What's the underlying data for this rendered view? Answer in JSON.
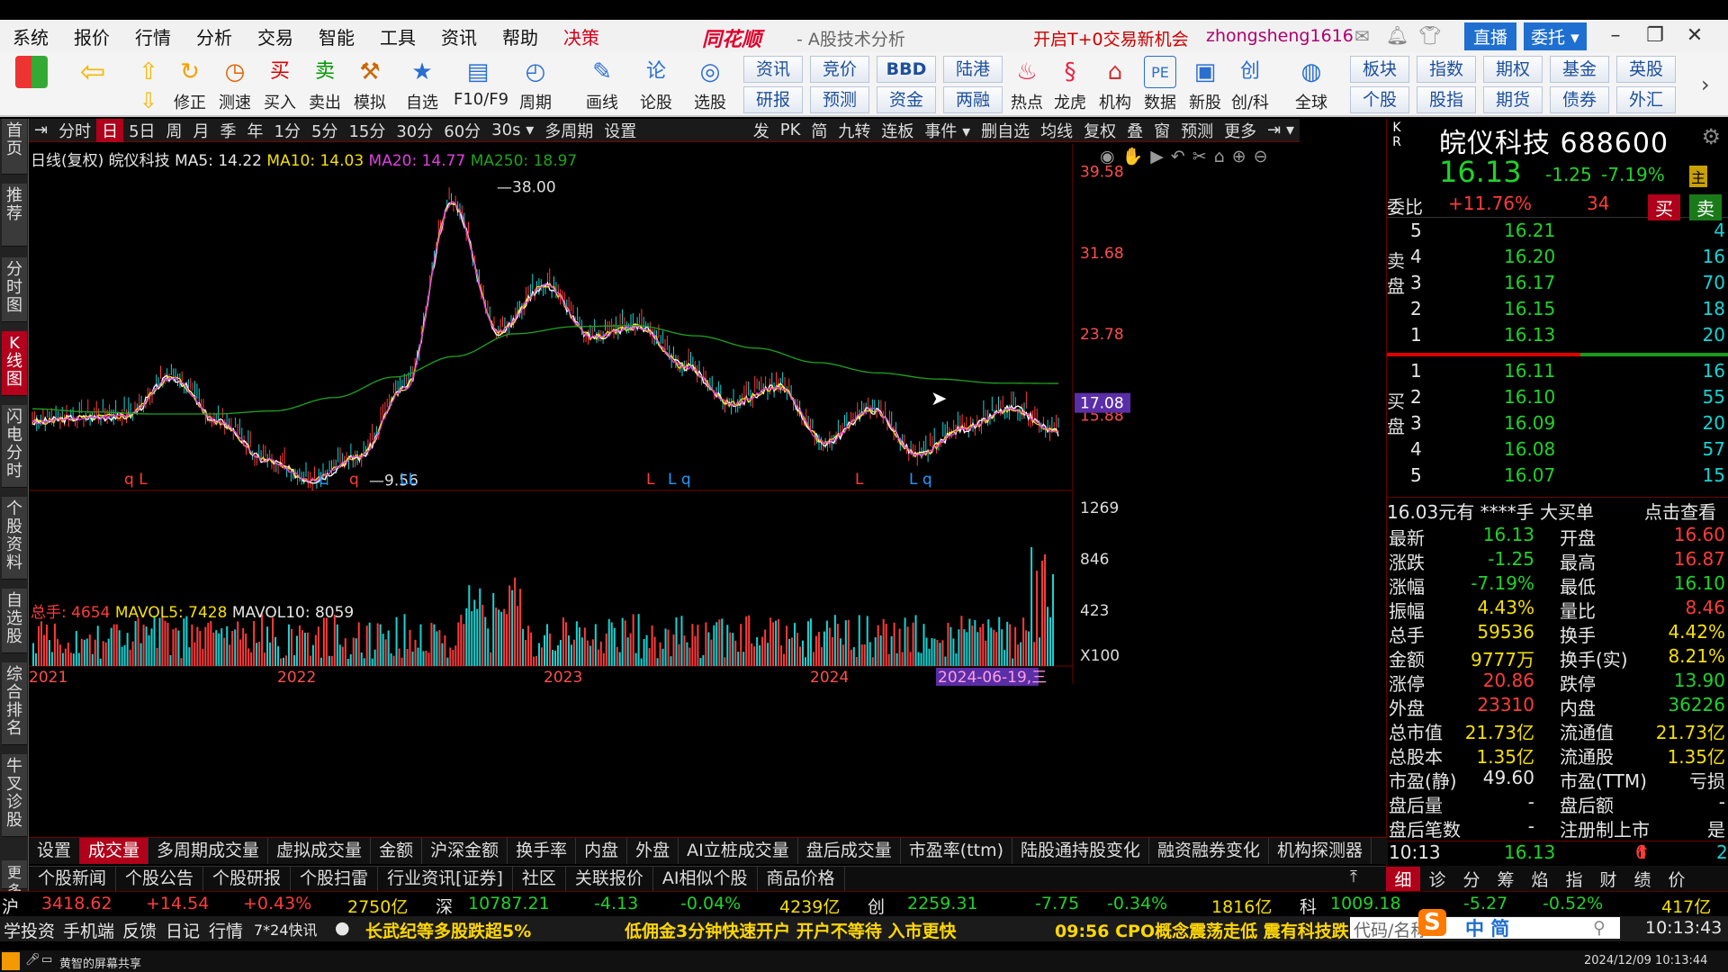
{
  "menu": {
    "items": [
      "系统",
      "报价",
      "行情",
      "分析",
      "交易",
      "智能",
      "工具",
      "资讯",
      "帮助",
      "决策"
    ],
    "brand": "同花顺",
    "subtitle": "- A股技术分析",
    "promo": "开启T+0交易新机会",
    "user": "zhongsheng1616",
    "live": "直播",
    "delegate": "委托"
  },
  "toolbar": {
    "buttons": [
      "修正",
      "测速",
      "买入",
      "卖出",
      "模拟",
      "自选",
      "F10/F9",
      "周期",
      "画线",
      "论股",
      "选股"
    ],
    "quick_top": [
      "资讯",
      "竞价",
      "BBD",
      "陆港"
    ],
    "quick_bottom": [
      "研报",
      "预测",
      "资金",
      "两融"
    ],
    "right_buttons": [
      "热点",
      "龙虎",
      "机构",
      "数据",
      "新股",
      "创/科",
      "全球"
    ],
    "right_quick_top": [
      "板块",
      "指数",
      "期权",
      "基金",
      "英股"
    ],
    "right_quick_bottom": [
      "个股",
      "股指",
      "期货",
      "债券",
      "外汇"
    ]
  },
  "left_tabs": [
    "首页",
    "推荐",
    "分时图",
    "K线图",
    "闪电分时",
    "个股资料",
    "自选股",
    "综合排名",
    "牛叉诊股",
    "更多"
  ],
  "chart_toolbar": {
    "periods": [
      "分时",
      "日",
      "5日",
      "周",
      "月",
      "季",
      "年",
      "1分",
      "5分",
      "15分",
      "30分",
      "60分",
      "30s",
      "多周期",
      "设置"
    ],
    "tools": [
      "发",
      "PK",
      "简",
      "九转",
      "连板",
      "事件",
      "删自选",
      "均线",
      "复权",
      "叠",
      "窗",
      "预测",
      "更多"
    ]
  },
  "chart_info": {
    "mode": "日线(复权)",
    "stock": "皖仪科技",
    "ma5_label": "MA5: 14.22",
    "ma10_label": "MA10: 14.03",
    "ma20_label": "MA20: 14.77",
    "ma250_label": "MA250: 18.97",
    "high_label": "38.00",
    "low_label": "9.56",
    "price_flag": "17.08",
    "vol_line_total": "总手: 4654",
    "vol_line_mavol5": "MAVOL5: 7428",
    "vol_line_mavol10": "MAVOL10: 8059",
    "vol_unit": "X100",
    "date_flag": "2024-06-19,三",
    "markers": [
      "q L",
      "L",
      "q",
      "LL",
      "L",
      "L q",
      "L",
      "L q"
    ]
  },
  "chart_data": {
    "type": "line",
    "title": "皖仪科技 日线(复权)",
    "x": [
      "2021",
      "2022",
      "2023",
      "2024"
    ],
    "price_ticks": [
      "39.58",
      "31.68",
      "23.78",
      "15.88"
    ],
    "volume_ticks": [
      "1269",
      "846",
      "423"
    ],
    "ylim": [
      9.0,
      40.5
    ],
    "series": [
      {
        "name": "MA250",
        "values": [
          16.5,
          16.2,
          16.0,
          16.0,
          16.3,
          17.6,
          19.6,
          21.6,
          23.8,
          24.5,
          24.6,
          23.6,
          22.4,
          21.0,
          20.0,
          19.4,
          19.0,
          18.97
        ]
      },
      {
        "name": "MA5",
        "values": [
          15.2,
          15.6,
          15.8,
          19.5,
          15.2,
          11.5,
          9.6,
          11.8,
          18.5,
          36.5,
          24.0,
          28.5,
          23.5,
          24.5,
          20.6,
          17.0,
          18.6,
          13.2,
          16.4,
          12.0,
          14.6,
          16.5,
          14.22
        ]
      }
    ],
    "volume": {
      "total": 4654,
      "mavol5": 7428,
      "mavol10": 8059
    }
  },
  "quote": {
    "kr": "K R",
    "name": "皖仪科技 688600",
    "price": "16.13",
    "change": "-1.25",
    "pct": "-7.19%",
    "zhu": "主",
    "weibi_label": "委比",
    "weibi_value": "+11.76%",
    "weicha": "34",
    "buy_btn": "买",
    "sell_btn": "卖",
    "sell_label": "卖盘",
    "buy_label": "买盘",
    "asks": [
      {
        "lvl": "5",
        "px": "16.21",
        "vol": "4"
      },
      {
        "lvl": "4",
        "px": "16.20",
        "vol": "16"
      },
      {
        "lvl": "3",
        "px": "16.17",
        "vol": "70"
      },
      {
        "lvl": "2",
        "px": "16.15",
        "vol": "18"
      },
      {
        "lvl": "1",
        "px": "16.13",
        "vol": "20"
      }
    ],
    "bids": [
      {
        "lvl": "1",
        "px": "16.11",
        "vol": "16"
      },
      {
        "lvl": "2",
        "px": "16.10",
        "vol": "55"
      },
      {
        "lvl": "3",
        "px": "16.09",
        "vol": "20"
      },
      {
        "lvl": "4",
        "px": "16.08",
        "vol": "57"
      },
      {
        "lvl": "5",
        "px": "16.07",
        "vol": "15"
      }
    ],
    "bigorder": "16.03元有 ****手 大买单",
    "bigorder_link": "点击查看",
    "stats": [
      {
        "l1": "最新",
        "v1": "16.13",
        "c1": "grn",
        "l2": "开盘",
        "v2": "16.60",
        "c2": "red"
      },
      {
        "l1": "涨跌",
        "v1": "-1.25",
        "c1": "grn",
        "l2": "最高",
        "v2": "16.87",
        "c2": "red"
      },
      {
        "l1": "涨幅",
        "v1": "-7.19%",
        "c1": "grn",
        "l2": "最低",
        "v2": "16.10",
        "c2": "grn"
      },
      {
        "l1": "振幅",
        "v1": "4.43%",
        "c1": "yel",
        "l2": "量比",
        "v2": "8.46",
        "c2": "red"
      },
      {
        "l1": "总手",
        "v1": "59536",
        "c1": "yel",
        "l2": "换手",
        "v2": "4.42%",
        "c2": "yel"
      },
      {
        "l1": "金额",
        "v1": "9777万",
        "c1": "yel",
        "l2": "换手(实)",
        "v2": "8.21%",
        "c2": "yel"
      },
      {
        "l1": "涨停",
        "v1": "20.86",
        "c1": "red",
        "l2": "跌停",
        "v2": "13.90",
        "c2": "grn"
      },
      {
        "l1": "外盘",
        "v1": "23310",
        "c1": "red",
        "l2": "内盘",
        "v2": "36226",
        "c2": "grn"
      },
      {
        "l1": "总市值",
        "v1": "21.73亿",
        "c1": "yel",
        "l2": "流通值",
        "v2": "21.73亿",
        "c2": "yel"
      },
      {
        "l1": "总股本",
        "v1": "1.35亿",
        "c1": "yel",
        "l2": "流通股",
        "v2": "1.35亿",
        "c2": "yel"
      },
      {
        "l1": "市盈(静)",
        "v1": "49.60",
        "c1": "wht",
        "l2": "市盈(TTM)",
        "v2": "亏损",
        "c2": "wht"
      },
      {
        "l1": "盘后量",
        "v1": "-",
        "c1": "wht",
        "l2": "盘后额",
        "v2": "-",
        "c2": "wht"
      },
      {
        "l1": "盘后笔数",
        "v1": "-",
        "c1": "wht",
        "l2": "注册制上市",
        "v2": "是",
        "c2": "wht"
      }
    ],
    "tick_time": "10:13",
    "tick_price": "16.13",
    "tick_vol": "6",
    "tick_count": "2"
  },
  "indicator_tabs": [
    "设置",
    "成交量",
    "多周期成交量",
    "虚拟成交量",
    "金额",
    "沪深金额",
    "换手率",
    "内盘",
    "外盘",
    "AI立桩成交量",
    "盘后成交量",
    "市盈率(ttm)",
    "陆股通持股变化",
    "融资融券变化",
    "机构探测器"
  ],
  "news_tabs": [
    "个股新闻",
    "个股公告",
    "个股研报",
    "个股扫雷",
    "行业资讯[证券]",
    "社区",
    "关联报价",
    "AI相似个股",
    "商品价格"
  ],
  "right_tabs": [
    "细",
    "诊",
    "分",
    "筹",
    "焰",
    "指",
    "财",
    "绩",
    "价"
  ],
  "index_bar": {
    "sh_label": "沪",
    "sh_val": "3418.62",
    "sh_chg": "+14.54",
    "sh_pct": "+0.43%",
    "sh_amt": "2750亿",
    "sz_label": "深",
    "sz_val": "10787.21",
    "sz_chg": "-4.13",
    "sz_pct": "-0.04%",
    "sz_amt": "4239亿",
    "cy_label": "创",
    "cy_val": "2259.31",
    "cy_chg": "-7.75",
    "cy_pct": "-0.34%",
    "cy_amt": "1816亿",
    "kc_label": "科",
    "kc_val": "1009.18",
    "kc_chg": "-5.27",
    "kc_pct": "-0.52%",
    "kc_amt": "417亿"
  },
  "ticker": {
    "items": [
      "学投资",
      "手机端",
      "反馈",
      "日记",
      "行情",
      "7*24快讯"
    ],
    "news1": "长武纪等多股跌超5%",
    "news2": "低佣金3分钟快速开户 开户不等待 入市更快",
    "news3": "09:56 CPO概念震荡走低 震有科技跌",
    "code_hint": "代码/名称",
    "ime": "中 简",
    "clock": "10:13:43"
  },
  "taskbar": {
    "text": "黄智的屏幕共享",
    "datetime": "2024/12/09 10:13:44"
  },
  "colors": {
    "up": "#ff3b3b",
    "down": "#1fd32b",
    "ma5": "#ffffff",
    "ma10": "#f5e000",
    "ma20": "#e040e0",
    "ma250": "#1fa31f",
    "accent": "#b0001a"
  }
}
